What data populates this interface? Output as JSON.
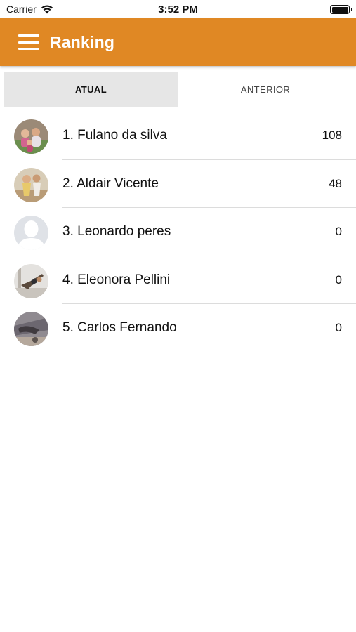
{
  "status_bar": {
    "carrier": "Carrier",
    "time": "3:52 PM"
  },
  "app_bar": {
    "title": "Ranking",
    "color": "#e08824"
  },
  "tabs": [
    {
      "label": "ATUAL",
      "selected": true
    },
    {
      "label": "ANTERIOR",
      "selected": false
    }
  ],
  "ranking": [
    {
      "name": "1. Fulano da silva",
      "score": "108",
      "avatar": "photo"
    },
    {
      "name": "2. Aldair Vicente",
      "score": "48",
      "avatar": "photo"
    },
    {
      "name": "3. Leonardo peres",
      "score": "0",
      "avatar": "default-avatar"
    },
    {
      "name": "4. Eleonora Pellini",
      "score": "0",
      "avatar": "photo"
    },
    {
      "name": "5. Carlos Fernando",
      "score": "0",
      "avatar": "photo"
    }
  ]
}
